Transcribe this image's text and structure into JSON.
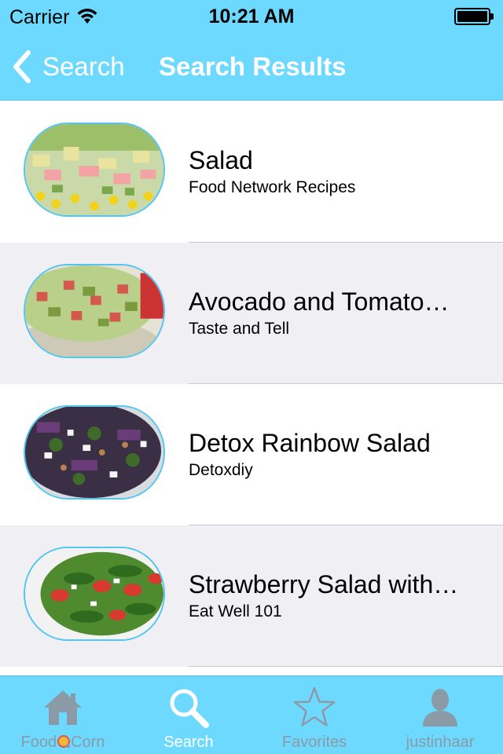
{
  "status_bar": {
    "carrier": "Carrier",
    "time": "10:21 AM",
    "battery_level": 1.0
  },
  "nav_bar": {
    "back_label": "Search",
    "title": "Search Results",
    "back_icon": "chevron-left-icon"
  },
  "results": [
    {
      "title": "Salad",
      "subtitle": "Food Network Recipes",
      "thumb_icon": "salad-photo"
    },
    {
      "title": "Avocado and Tomato…",
      "subtitle": "Taste and Tell",
      "thumb_icon": "avocado-salad-photo"
    },
    {
      "title": "Detox Rainbow Salad",
      "subtitle": "Detoxdiy",
      "thumb_icon": "rainbow-salad-photo"
    },
    {
      "title": "Strawberry Salad with…",
      "subtitle": "Eat Well 101",
      "thumb_icon": "strawberry-salad-photo"
    }
  ],
  "tab_bar": {
    "tabs": [
      {
        "label_prefix": "Food",
        "label_suffix": "Corn",
        "icon": "house-icon",
        "active": false
      },
      {
        "label": "Search",
        "icon": "search-icon",
        "active": true
      },
      {
        "label": "Favorites",
        "icon": "star-icon",
        "active": false
      },
      {
        "label": "justinhaar",
        "icon": "person-icon",
        "active": false
      }
    ]
  },
  "colors": {
    "bar_background": "#6dd9ff",
    "thumb_border": "#53c5f0",
    "alt_row": "#efeff4",
    "inactive_tab": "#8a9aa6",
    "active_tab": "#ffffff"
  }
}
